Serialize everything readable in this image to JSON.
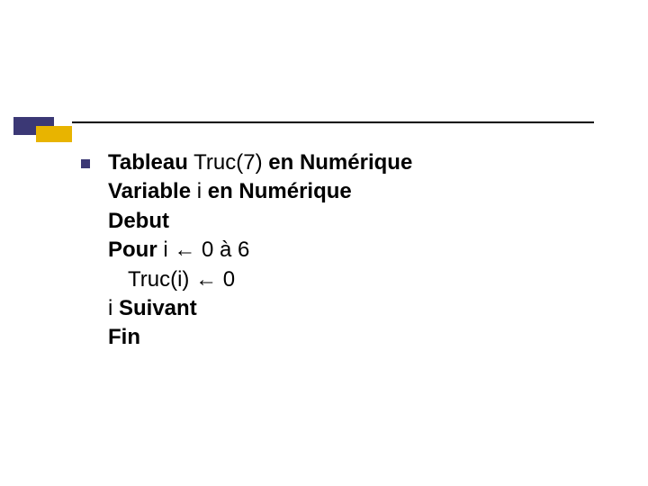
{
  "code": {
    "l1_b1": "Tableau",
    "l1_r1": " Truc(7) ",
    "l1_b2": "en Numérique",
    "l2_b1": "Variable",
    "l2_r1": " i ",
    "l2_b2": "en Numérique",
    "l3_b1": "Debut",
    "l4_b1": "Pour",
    "l4_r1": " i ← 0 à 6",
    "l5_r1": "Truc(i) ← 0",
    "l6_r1": "i ",
    "l6_b1": "Suivant",
    "l7_b1": "Fin"
  }
}
